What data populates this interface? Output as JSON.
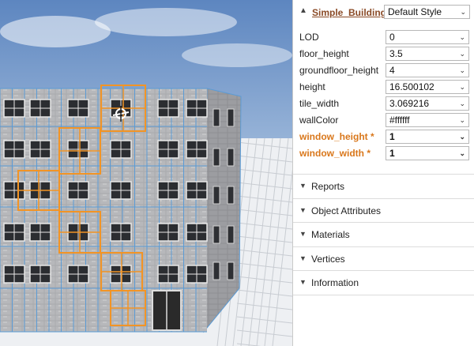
{
  "rule_panel": {
    "rule_name": "Simple_Building",
    "style_selector": "Default Style",
    "collapse_icon": "chevron-up-icon",
    "attributes": [
      {
        "name": "LOD",
        "value": "0",
        "highlight": false
      },
      {
        "name": "floor_height",
        "value": "3.5",
        "highlight": false
      },
      {
        "name": "groundfloor_height",
        "value": "4",
        "highlight": false
      },
      {
        "name": "height",
        "value": "16.500102",
        "highlight": false
      },
      {
        "name": "tile_width",
        "value": "3.069216",
        "highlight": false
      },
      {
        "name": "wallColor",
        "value": "#ffffff",
        "highlight": false
      },
      {
        "name": "window_height *",
        "value": "1",
        "highlight": true
      },
      {
        "name": "window_width *",
        "value": "1",
        "highlight": true
      }
    ],
    "highlight_color": "#d9771b"
  },
  "sections": [
    {
      "label": "Reports",
      "icon": "chevron-down-icon"
    },
    {
      "label": "Object Attributes",
      "icon": "chevron-down-icon"
    },
    {
      "label": "Materials",
      "icon": "chevron-down-icon"
    },
    {
      "label": "Vertices",
      "icon": "chevron-down-icon"
    },
    {
      "label": "Information",
      "icon": "chevron-down-icon"
    }
  ],
  "viewport": {
    "sky_color": "#6f93c4",
    "grid_color": "#c8ccd2",
    "building_edge_color": "#5b9bd5",
    "selection_color": "#f29425"
  }
}
